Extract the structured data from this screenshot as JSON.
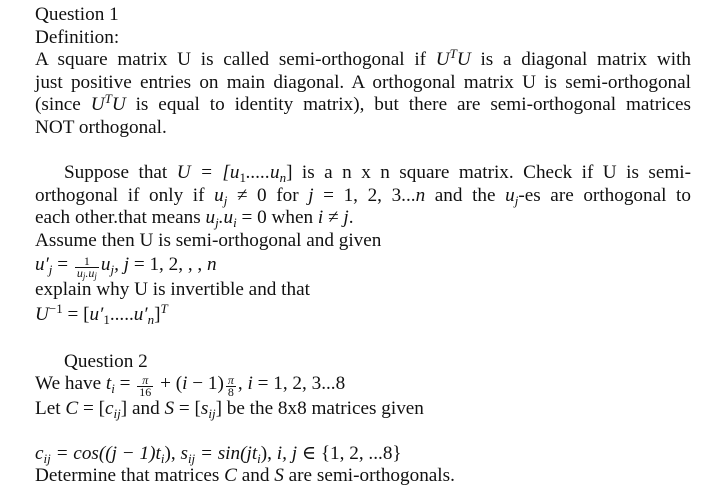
{
  "question1": {
    "title": "Question 1",
    "definition_label": "Definition:",
    "definition_lines": [
      [
        "A square matrix U is called semi-orthogonal if ",
        "U",
        "T",
        "U",
        " is a diagonal matrix with"
      ],
      "just positive entries on main diagonal.  A orthogonal matrix U is semi-orthogonal",
      [
        "(since ",
        "U",
        "T",
        "U",
        " is equal to identity matrix), but there are semi-orthogonal matrices"
      ],
      "NOT orthogonal."
    ],
    "suppose": {
      "l1_pre": "Suppose that ",
      "l1_math": "U = [u",
      "l1_sub1": "1",
      "l1_mid": ".....u",
      "l1_subn": "n",
      "l1_close": "]",
      "l1_post": " is a n x n square matrix.  Check if U is semi-",
      "l2_pre": "orthogonal if only if ",
      "l2_m1": "u",
      "l2_s1": "j",
      "l2_m2": " ≠ 0",
      "l2_for": " for ",
      "l2_m3": "j",
      "l2_m4": " = 1, 2, 3...",
      "l2_m5": "n",
      "l2_and": " and the ",
      "l2_m6": "u",
      "l2_s6": "j",
      "l2_post": "-es are orthogonal to",
      "l3_pre": "each other.that means ",
      "l3_m1": "u",
      "l3_s1": "j",
      "l3_m2": ".u",
      "l3_s2": "i",
      "l3_m3": " = 0",
      "l3_when": " when ",
      "l3_m4": "i",
      "l3_m5": " ≠ ",
      "l3_m6": "j",
      "l3_end": "."
    },
    "assume": "Assume then U is semi-orthogonal and given",
    "formula": {
      "lhs": "u′",
      "lhs_sub": "j",
      "eq": " = ",
      "frac_num": "1",
      "frac_den": "u_j.u_j",
      "rhs": "u",
      "rhs_sub": "j",
      "tail_m": ", j",
      "tail": " = 1, 2, , , ",
      "tail_n": "n"
    },
    "explain": "explain why U is invertible and that",
    "inverse": {
      "u": "U",
      "sup": "−1",
      "eq": " = [",
      "u1": "u′",
      "u1_sub": "1",
      "dots": ".....",
      "un": "u′",
      "un_sub": "n",
      "close": "]",
      "t": "T"
    }
  },
  "question2": {
    "title": "Question 2",
    "t_def": {
      "pre": "We have ",
      "t": "t",
      "t_sub": "i",
      "eq": " = ",
      "f1_num": "π",
      "f1_den": "16",
      "plus": " + (",
      "i": "i",
      "minus": " − 1)",
      "f2_num": "π",
      "f2_den": "8",
      "comma": ", ",
      "i2": "i",
      "range": " = 1, 2, 3...8"
    },
    "let": {
      "pre": "Let ",
      "C": "C",
      "eq1": " = [",
      "c": "c",
      "c_sub": "ij",
      "close1": "]",
      "and": " and ",
      "S": "S",
      "eq2": " = [",
      "s": "s",
      "s_sub": "ij",
      "close2": "]",
      "post": " be the 8x8 matrices given"
    },
    "entries": {
      "c": "c",
      "c_sub": "ij",
      "c_def": " = cos((j − 1)t",
      "c_t_sub": "i",
      "c_close": "),  ",
      "s": "s",
      "s_sub": "ij",
      "s_def": " = sin(jt",
      "s_t_sub": "i",
      "s_close": "),  ",
      "idx": "i, j",
      "in": " ∈ {1, 2, ...8}"
    },
    "determine": {
      "pre": "Determine that matrices ",
      "C": "C",
      "and": " and ",
      "S": "S",
      "post": " are semi-orthogonals."
    }
  }
}
